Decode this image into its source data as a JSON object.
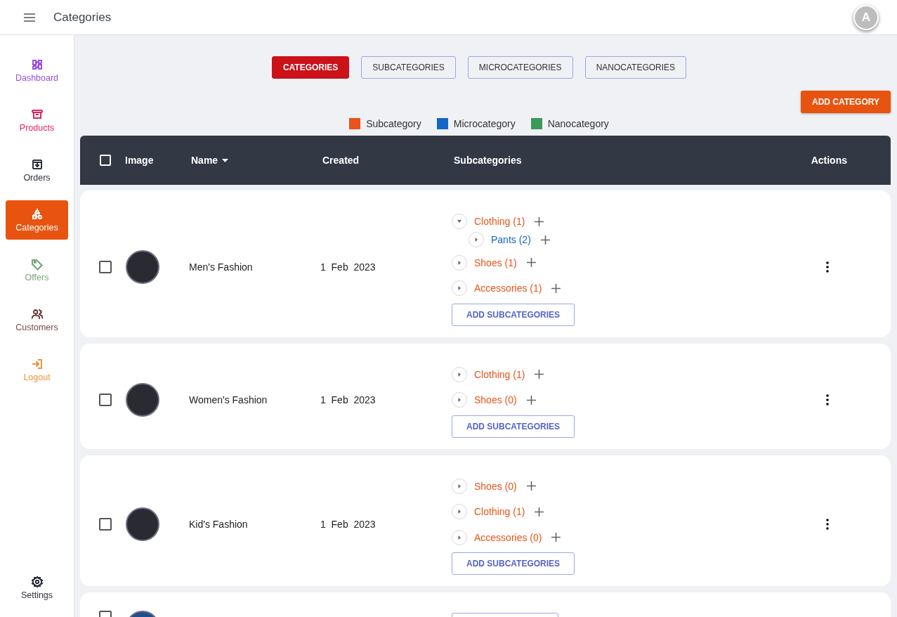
{
  "header": {
    "title": "Categories",
    "avatar_initial": "A"
  },
  "sidebar": {
    "items": [
      {
        "label": "Dashboard",
        "color": "#9b4fe0",
        "selected": false
      },
      {
        "label": "Products",
        "color": "#e2245f",
        "selected": false
      },
      {
        "label": "Orders",
        "color": "#2f3340",
        "selected": false
      },
      {
        "label": "Categories",
        "color": "#ffffff",
        "selected": true
      },
      {
        "label": "Offers",
        "color": "#77a57a",
        "selected": false
      },
      {
        "label": "Customers",
        "color": "#7b4b4b",
        "selected": false
      },
      {
        "label": "Logout",
        "color": "#f0923a",
        "selected": false
      }
    ],
    "footer_item": {
      "label": "Settings"
    }
  },
  "tabs": [
    {
      "label": "CATEGORIES",
      "selected": true
    },
    {
      "label": "SUBCATEGORIES",
      "selected": false
    },
    {
      "label": "MICROCATEGORIES",
      "selected": false
    },
    {
      "label": "NANOCATEGORIES",
      "selected": false
    }
  ],
  "add_button": "ADD CATEGORY",
  "legend": [
    {
      "label": "Subcategory",
      "color": "#e8541a"
    },
    {
      "label": "Microcategory",
      "color": "#1366c8"
    },
    {
      "label": "Nanocategory",
      "color": "#3a9a5a"
    }
  ],
  "table": {
    "columns": [
      {
        "label": "Image",
        "sorted": false
      },
      {
        "label": "Name",
        "sorted": true
      },
      {
        "label": "Created",
        "sorted": false
      },
      {
        "label": "Subcategories",
        "sorted": false
      },
      {
        "label": "Actions",
        "sorted": false
      }
    ],
    "all_checked": false,
    "rows": [
      {
        "checked": false,
        "name": "Men's Fashion",
        "created": "1  Feb  2023",
        "button": "ADD SUBCATEGORIES",
        "subcategories": [
          {
            "label": "Clothing (1)",
            "kind": "subcategory",
            "expanded": true,
            "children": [
              {
                "label": "Pants (2)",
                "kind": "microcategory",
                "expanded": false
              }
            ]
          },
          {
            "label": "Shoes (1)",
            "kind": "subcategory",
            "expanded": false
          },
          {
            "label": "Accessories (1)",
            "kind": "subcategory",
            "expanded": false
          }
        ]
      },
      {
        "checked": false,
        "name": "Women's Fashion",
        "created": "1  Feb  2023",
        "button": "ADD SUBCATEGORIES",
        "subcategories": [
          {
            "label": "Clothing (1)",
            "kind": "subcategory",
            "expanded": false
          },
          {
            "label": "Shoes (0)",
            "kind": "subcategory",
            "expanded": false
          }
        ]
      },
      {
        "checked": false,
        "name": "Kid's Fashion",
        "created": "1  Feb  2023",
        "button": "ADD SUBCATEGORIES",
        "subcategories": [
          {
            "label": "Shoes (0)",
            "kind": "subcategory",
            "expanded": false
          },
          {
            "label": "Clothing (1)",
            "kind": "subcategory",
            "expanded": false
          },
          {
            "label": "Accessories (0)",
            "kind": "subcategory",
            "expanded": false
          }
        ]
      },
      {
        "checked": false,
        "kind": "partial"
      }
    ]
  }
}
